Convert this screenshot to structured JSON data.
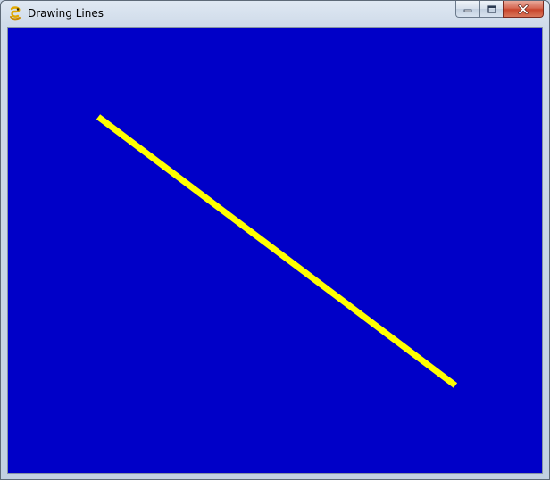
{
  "window": {
    "title": "Drawing Lines",
    "icon": "pygame-snake-icon",
    "buttons": {
      "minimize": "minimize-icon",
      "maximize": "maximize-icon",
      "close": "close-icon"
    }
  },
  "canvas": {
    "background_color": "#0000c8",
    "line": {
      "color": "#ffff00"
    }
  }
}
